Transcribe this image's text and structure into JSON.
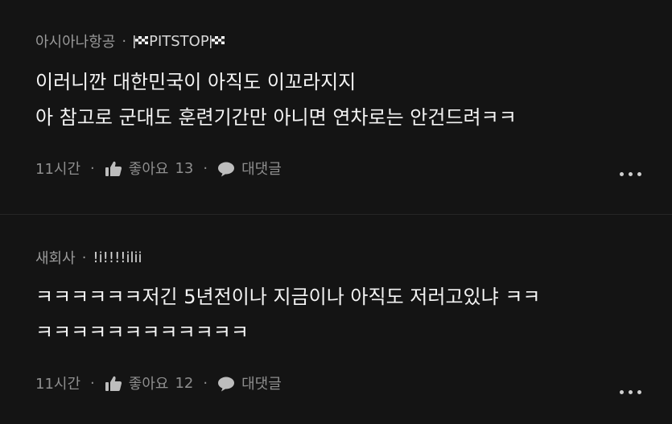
{
  "comments": [
    {
      "author": "아시아나항공",
      "separator": "·",
      "nickname": "PITSTOP",
      "lines": [
        "이러니깐 대한민국이 아직도 이꼬라지지",
        "아 참고로 군대도 훈련기간만 아니면 연차로는 안건드려ㅋㅋ"
      ],
      "time": "11시간",
      "like_label": "좋아요",
      "like_count": "13",
      "reply_label": "대댓글"
    },
    {
      "author": "새회사",
      "separator": "·",
      "nickname": "!i!!!!ilii",
      "lines": [
        "ㅋㅋㅋㅋㅋㅋ저긴 5년전이나 지금이나 아직도 저러고있냐 ㅋㅋ",
        "ㅋㅋㅋㅋㅋㅋㅋㅋㅋㅋㅋㅋ"
      ],
      "time": "11시간",
      "like_label": "좋아요",
      "like_count": "12",
      "reply_label": "대댓글"
    }
  ],
  "icons": {
    "like": "thumbs-up-icon",
    "reply": "speech-bubble-icon",
    "more": "more-horizontal-icon",
    "flag": "checkered-flag-icon"
  },
  "colors": {
    "background": "#141414",
    "meta_text": "#9a9a9a",
    "body_text": "#f4f4f4"
  }
}
